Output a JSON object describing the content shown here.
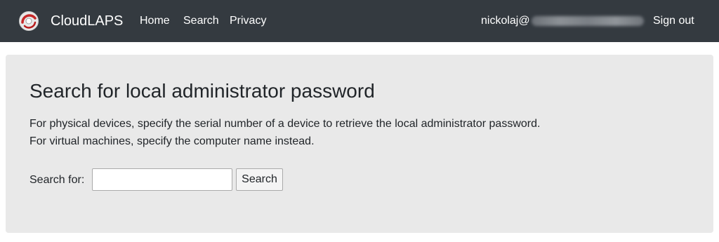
{
  "nav": {
    "brand": "CloudLAPS",
    "links": [
      {
        "label": "Home"
      },
      {
        "label": "Search"
      },
      {
        "label": "Privacy"
      }
    ],
    "user_prefix": "nickolaj@",
    "sign_out": "Sign out",
    "logo_icon": "cloudlaps-logo-icon"
  },
  "main": {
    "title": "Search for local administrator password",
    "description_lines": [
      "For physical devices, specify the serial number of a device to retrieve the local administrator password.",
      "For virtual machines, specify the computer name instead."
    ],
    "search_label": "Search for:",
    "search_value": "",
    "search_placeholder": "",
    "search_button": "Search"
  },
  "colors": {
    "navbar_bg": "#343a40",
    "panel_bg": "#e9e9e9",
    "logo_accent": "#c62828"
  }
}
